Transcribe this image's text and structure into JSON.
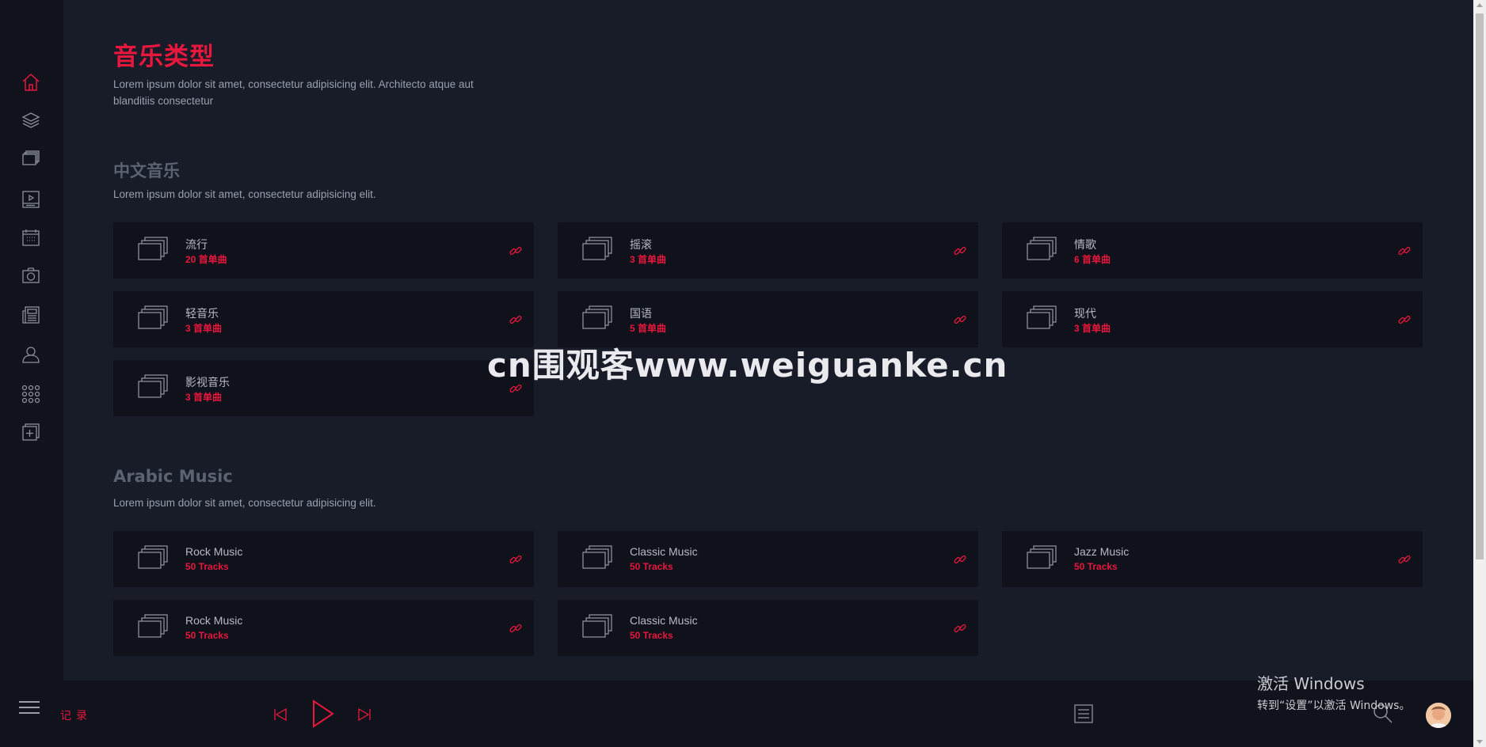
{
  "page": {
    "title": "音乐类型",
    "description": "Lorem ipsum dolor sit amet, consectetur adipisicing elit. Architecto atque aut blanditiis consectetur"
  },
  "sidebar": {
    "items": [
      {
        "name": "home-icon",
        "active": true
      },
      {
        "name": "layers-icon",
        "active": false
      },
      {
        "name": "albums-icon",
        "active": false
      },
      {
        "name": "video-icon",
        "active": false
      },
      {
        "name": "calendar-icon",
        "active": false
      },
      {
        "name": "camera-icon",
        "active": false
      },
      {
        "name": "news-icon",
        "active": false
      },
      {
        "name": "user-icon",
        "active": false
      },
      {
        "name": "grid-icon",
        "active": false
      },
      {
        "name": "add-playlist-icon",
        "active": false
      }
    ]
  },
  "sections": [
    {
      "title": "中文音乐",
      "description": "Lorem ipsum dolor sit amet, consectetur adipisicing elit.",
      "cards": [
        {
          "name": "流行",
          "count": "20 首单曲"
        },
        {
          "name": "摇滚",
          "count": "3 首单曲"
        },
        {
          "name": "情歌",
          "count": "6 首单曲"
        },
        {
          "name": "轻音乐",
          "count": "3 首单曲"
        },
        {
          "name": "国语",
          "count": "5 首单曲"
        },
        {
          "name": "现代",
          "count": "3 首单曲"
        },
        {
          "name": "影视音乐",
          "count": "3 首单曲"
        }
      ]
    },
    {
      "title": "Arabic Music",
      "description": "Lorem ipsum dolor sit amet, consectetur adipisicing elit.",
      "cards": [
        {
          "name": "Rock Music",
          "count": "50 Tracks"
        },
        {
          "name": "Classic Music",
          "count": "50 Tracks"
        },
        {
          "name": "Jazz Music",
          "count": "50 Tracks"
        },
        {
          "name": "Rock Music",
          "count": "50 Tracks"
        },
        {
          "name": "Classic Music",
          "count": "50 Tracks"
        }
      ]
    }
  ],
  "player": {
    "history_label": "记录"
  },
  "watermark": "cn围观客www.weiguanke.cn",
  "windows_activation": {
    "title": "激活 Windows",
    "subtitle": "转到“设置”以激活 Windows。"
  },
  "colors": {
    "accent": "#e8173d",
    "background": "#181c29",
    "sidebar": "#10131c",
    "card": "#0f121b"
  }
}
